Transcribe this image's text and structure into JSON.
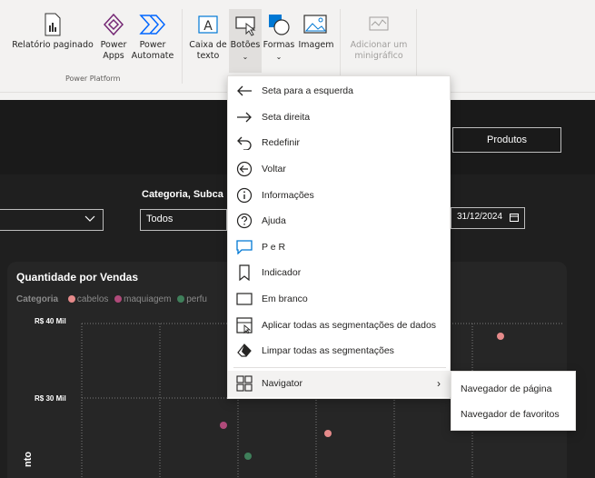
{
  "ribbon": {
    "paginated_report": "Relatório paginado",
    "power_apps_line1": "Power",
    "power_apps_line2": "Apps",
    "power_automate_line1": "Power",
    "power_automate_line2": "Automate",
    "group_power_platform": "Power Platform",
    "text_box_line1": "Caixa de",
    "text_box_line2": "texto",
    "buttons": "Botões",
    "shapes": "Formas",
    "image": "Imagem",
    "sparkline_line1": "Adicionar um",
    "sparkline_line2": "minigráfico",
    "chevron": "⌄"
  },
  "report": {
    "produtos_button": "Produtos",
    "category_slicer_title": "Categoria, Subca",
    "category_slicer_value": "Todos",
    "date_value": "31/12/2024",
    "chart_title": "Quantidade por Vendas",
    "legend_title": "Categoria",
    "legend_items": [
      {
        "label": "cabelos",
        "color": "#e58a8a"
      },
      {
        "label": "maquiagem",
        "color": "#b04a7a"
      },
      {
        "label": "perfu",
        "color": "#3f7f5a"
      }
    ],
    "y_axis_label": "nto"
  },
  "chart_data": {
    "type": "scatter",
    "title": "Quantidade por Vendas",
    "yticks": [
      "R$ 40 Mil",
      "R$ 30 Mil"
    ],
    "points": [
      {
        "series": "cabelos",
        "y_label_near": "R$ 40 Mil",
        "color": "#e58a8a"
      },
      {
        "series": "maquiagem",
        "color": "#b04a7a"
      },
      {
        "series": "cabelos",
        "color": "#e58a8a"
      },
      {
        "series": "perfu",
        "color": "#3f7f5a"
      }
    ]
  },
  "menu": {
    "items": [
      {
        "label": "Seta para a esquerda",
        "icon": "arrow-left-icon"
      },
      {
        "label": "Seta direita",
        "icon": "arrow-right-icon"
      },
      {
        "label": "Redefinir",
        "icon": "reset-icon"
      },
      {
        "label": "Voltar",
        "icon": "back-circle-icon"
      },
      {
        "label": "Informações",
        "icon": "info-icon"
      },
      {
        "label": "Ajuda",
        "icon": "help-icon"
      },
      {
        "label": "P e R",
        "icon": "qna-icon"
      },
      {
        "label": "Indicador",
        "icon": "bookmark-icon"
      },
      {
        "label": "Em branco",
        "icon": "blank-icon"
      },
      {
        "label": "Aplicar todas as segmentações de dados",
        "icon": "apply-slicers-icon"
      },
      {
        "label": "Limpar todas as segmentações",
        "icon": "clear-slicers-icon"
      }
    ],
    "navigator": {
      "label": "Navigator",
      "icon": "navigator-icon",
      "arrow": "›"
    }
  },
  "submenu": {
    "items": [
      {
        "label": "Navegador de página"
      },
      {
        "label": "Navegador de favoritos"
      }
    ]
  }
}
